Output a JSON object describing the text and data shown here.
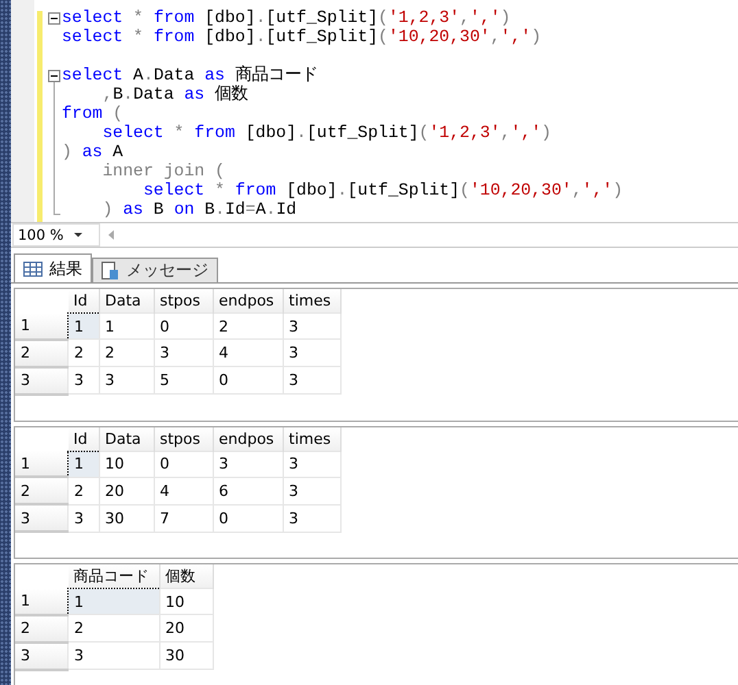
{
  "editor": {
    "blocks": [
      {
        "expanded": true,
        "lines": [
          [
            {
              "kind": "kw",
              "text": "select"
            },
            {
              "kind": "op",
              "text": " * "
            },
            {
              "kind": "kw",
              "text": "from"
            },
            {
              "kind": "tx",
              "text": " [dbo]"
            },
            {
              "kind": "op",
              "text": "."
            },
            {
              "kind": "tx",
              "text": "[utf_Split]"
            },
            {
              "kind": "op",
              "text": "("
            },
            {
              "kind": "str",
              "text": "'1,2,3'"
            },
            {
              "kind": "op",
              "text": ","
            },
            {
              "kind": "str",
              "text": "','"
            },
            {
              "kind": "op",
              "text": ")"
            }
          ],
          [
            {
              "kind": "kw",
              "text": "select"
            },
            {
              "kind": "op",
              "text": " * "
            },
            {
              "kind": "kw",
              "text": "from"
            },
            {
              "kind": "tx",
              "text": " [dbo]"
            },
            {
              "kind": "op",
              "text": "."
            },
            {
              "kind": "tx",
              "text": "[utf_Split]"
            },
            {
              "kind": "op",
              "text": "("
            },
            {
              "kind": "str",
              "text": "'10,20,30'"
            },
            {
              "kind": "op",
              "text": ","
            },
            {
              "kind": "str",
              "text": "','"
            },
            {
              "kind": "op",
              "text": ")"
            }
          ]
        ]
      },
      {
        "expanded": true,
        "lines": [
          [
            {
              "kind": "kw",
              "text": "select"
            },
            {
              "kind": "tx",
              "text": " A"
            },
            {
              "kind": "op",
              "text": "."
            },
            {
              "kind": "tx",
              "text": "Data "
            },
            {
              "kind": "kw",
              "text": "as"
            },
            {
              "kind": "tx",
              "text": " 商品コード"
            }
          ],
          [
            {
              "kind": "op",
              "text": "    ,"
            },
            {
              "kind": "tx",
              "text": "B"
            },
            {
              "kind": "op",
              "text": "."
            },
            {
              "kind": "tx",
              "text": "Data "
            },
            {
              "kind": "kw",
              "text": "as"
            },
            {
              "kind": "tx",
              "text": " 個数"
            }
          ],
          [
            {
              "kind": "kw",
              "text": "from"
            },
            {
              "kind": "op",
              "text": " ("
            }
          ],
          [
            {
              "kind": "kw",
              "text": "    select"
            },
            {
              "kind": "op",
              "text": " * "
            },
            {
              "kind": "kw",
              "text": "from"
            },
            {
              "kind": "tx",
              "text": " [dbo]"
            },
            {
              "kind": "op",
              "text": "."
            },
            {
              "kind": "tx",
              "text": "[utf_Split]"
            },
            {
              "kind": "op",
              "text": "("
            },
            {
              "kind": "str",
              "text": "'1,2,3'"
            },
            {
              "kind": "op",
              "text": ","
            },
            {
              "kind": "str",
              "text": "','"
            },
            {
              "kind": "op",
              "text": ")"
            }
          ],
          [
            {
              "kind": "op",
              "text": ")"
            },
            {
              "kind": "kw",
              "text": " as"
            },
            {
              "kind": "tx",
              "text": " A"
            }
          ],
          [
            {
              "kind": "op",
              "text": "    inner join ("
            }
          ],
          [
            {
              "kind": "kw",
              "text": "        select"
            },
            {
              "kind": "op",
              "text": " * "
            },
            {
              "kind": "kw",
              "text": "from"
            },
            {
              "kind": "tx",
              "text": " [dbo]"
            },
            {
              "kind": "op",
              "text": "."
            },
            {
              "kind": "tx",
              "text": "[utf_Split]"
            },
            {
              "kind": "op",
              "text": "("
            },
            {
              "kind": "str",
              "text": "'10,20,30'"
            },
            {
              "kind": "op",
              "text": ","
            },
            {
              "kind": "str",
              "text": "','"
            },
            {
              "kind": "op",
              "text": ")"
            }
          ],
          [
            {
              "kind": "op",
              "text": "    )"
            },
            {
              "kind": "kw",
              "text": " as"
            },
            {
              "kind": "tx",
              "text": " B "
            },
            {
              "kind": "kw",
              "text": "on"
            },
            {
              "kind": "tx",
              "text": " B"
            },
            {
              "kind": "op",
              "text": "."
            },
            {
              "kind": "tx",
              "text": "Id"
            },
            {
              "kind": "op",
              "text": "="
            },
            {
              "kind": "tx",
              "text": "A"
            },
            {
              "kind": "op",
              "text": "."
            },
            {
              "kind": "tx",
              "text": "Id"
            }
          ]
        ]
      }
    ]
  },
  "zoom": {
    "value": "100 %"
  },
  "tabs": [
    {
      "label": "結果",
      "selected": true
    },
    {
      "label": "メッセージ",
      "selected": false
    }
  ],
  "grids": [
    {
      "columns": [
        "Id",
        "Data",
        "stpos",
        "endpos",
        "times"
      ],
      "rows": [
        {
          "header": "1",
          "cells": [
            {
              "text": "1",
              "selected": true
            },
            {
              "text": "1",
              "selected": false
            },
            {
              "text": "0",
              "selected": false
            },
            {
              "text": "2",
              "selected": false
            },
            {
              "text": "3",
              "selected": false
            }
          ]
        },
        {
          "header": "2",
          "cells": [
            {
              "text": "2",
              "selected": false
            },
            {
              "text": "2",
              "selected": false
            },
            {
              "text": "3",
              "selected": false
            },
            {
              "text": "4",
              "selected": false
            },
            {
              "text": "3",
              "selected": false
            }
          ]
        },
        {
          "header": "3",
          "cells": [
            {
              "text": "3",
              "selected": false
            },
            {
              "text": "3",
              "selected": false
            },
            {
              "text": "5",
              "selected": false
            },
            {
              "text": "0",
              "selected": false
            },
            {
              "text": "3",
              "selected": false
            }
          ]
        }
      ]
    },
    {
      "columns": [
        "Id",
        "Data",
        "stpos",
        "endpos",
        "times"
      ],
      "rows": [
        {
          "header": "1",
          "cells": [
            {
              "text": "1",
              "selected": true
            },
            {
              "text": "10",
              "selected": false
            },
            {
              "text": "0",
              "selected": false
            },
            {
              "text": "3",
              "selected": false
            },
            {
              "text": "3",
              "selected": false
            }
          ]
        },
        {
          "header": "2",
          "cells": [
            {
              "text": "2",
              "selected": false
            },
            {
              "text": "20",
              "selected": false
            },
            {
              "text": "4",
              "selected": false
            },
            {
              "text": "6",
              "selected": false
            },
            {
              "text": "3",
              "selected": false
            }
          ]
        },
        {
          "header": "3",
          "cells": [
            {
              "text": "3",
              "selected": false
            },
            {
              "text": "30",
              "selected": false
            },
            {
              "text": "7",
              "selected": false
            },
            {
              "text": "0",
              "selected": false
            },
            {
              "text": "3",
              "selected": false
            }
          ]
        }
      ]
    },
    {
      "columns": [
        "商品コード",
        "個数"
      ],
      "rows": [
        {
          "header": "1",
          "cells": [
            {
              "text": "1",
              "selected": true
            },
            {
              "text": "10",
              "selected": false
            }
          ]
        },
        {
          "header": "2",
          "cells": [
            {
              "text": "2",
              "selected": false
            },
            {
              "text": "20",
              "selected": false
            }
          ]
        },
        {
          "header": "3",
          "cells": [
            {
              "text": "3",
              "selected": false
            },
            {
              "text": "30",
              "selected": false
            }
          ]
        }
      ]
    }
  ]
}
